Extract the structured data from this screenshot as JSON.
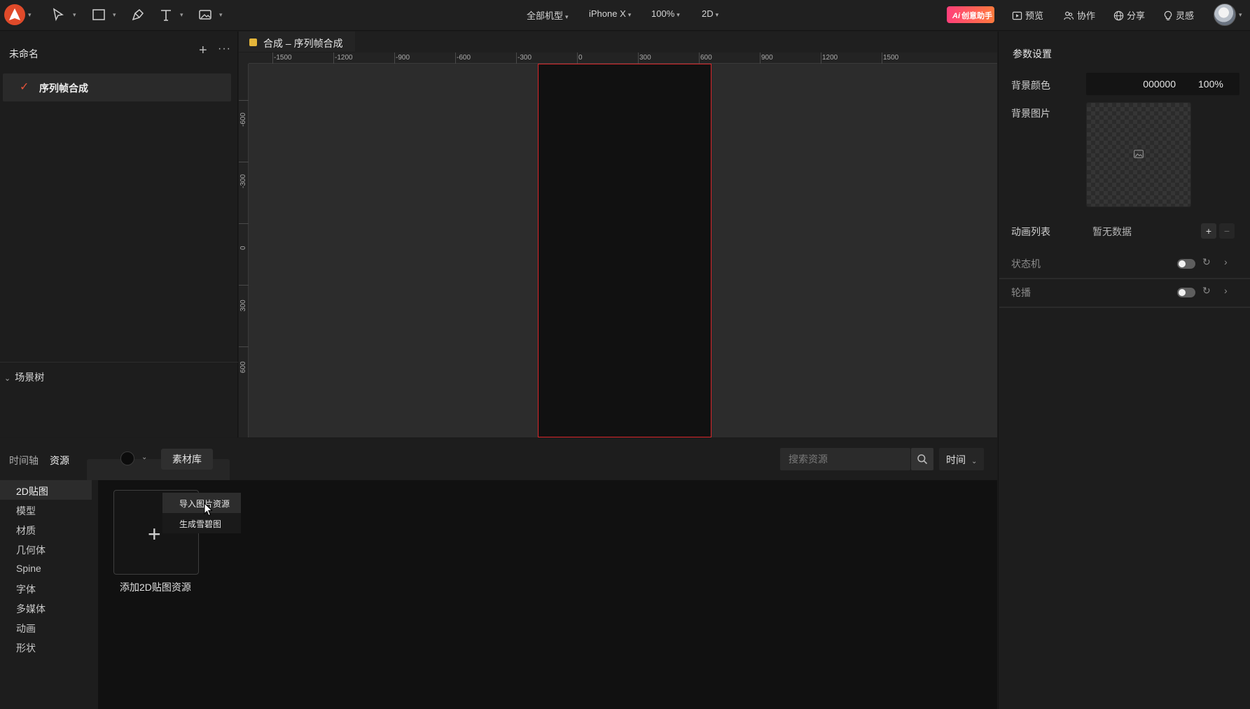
{
  "toolbar": {
    "device_menu": "全部机型",
    "phone_menu": "iPhone X",
    "zoom_menu": "100%",
    "mode_menu": "2D",
    "ai_badge": "创意助手",
    "preview": "预览",
    "collaborate": "协作",
    "share": "分享",
    "inspiration": "灵感"
  },
  "left_panel": {
    "title": "未命名",
    "items": [
      {
        "label": "序列帧合成",
        "checked": true
      }
    ],
    "scene_tree": "场景树"
  },
  "canvas": {
    "tab": "合成 – 序列帧合成",
    "ruler_h": [
      "-1500",
      "-1200",
      "-900",
      "-600",
      "-300",
      "0",
      "300",
      "600",
      "900",
      "1200",
      "1500"
    ],
    "ruler_v": [
      "-600",
      "-300",
      "0",
      "300",
      "600"
    ]
  },
  "right_panel": {
    "title": "参数设置",
    "bg_color_label": "背景颜色",
    "bg_color_hex": "000000",
    "bg_color_opacity": "100%",
    "bg_image_label": "背景图片",
    "animation_list_label": "动画列表",
    "animation_list_empty": "暂无数据",
    "state_machine_label": "状态机",
    "carousel_label": "轮播",
    "add_symbol": "+",
    "remove_symbol": "−"
  },
  "bottom": {
    "tabs": [
      "时间轴",
      "资源"
    ],
    "library_button": "素材库",
    "search_placeholder": "搜索资源",
    "sort": "时间",
    "categories": [
      "2D贴图",
      "模型",
      "材质",
      "几何体",
      "Spine",
      "字体",
      "多媒体",
      "动画",
      "形状"
    ],
    "add_label": "添加2D贴图资源",
    "context_menu": [
      "导入图片资源",
      "生成雪碧图"
    ]
  },
  "colors": {
    "accent": "#e04a2a",
    "artboard_border": "#d9262a",
    "tab_dot": "#e4b53a"
  }
}
